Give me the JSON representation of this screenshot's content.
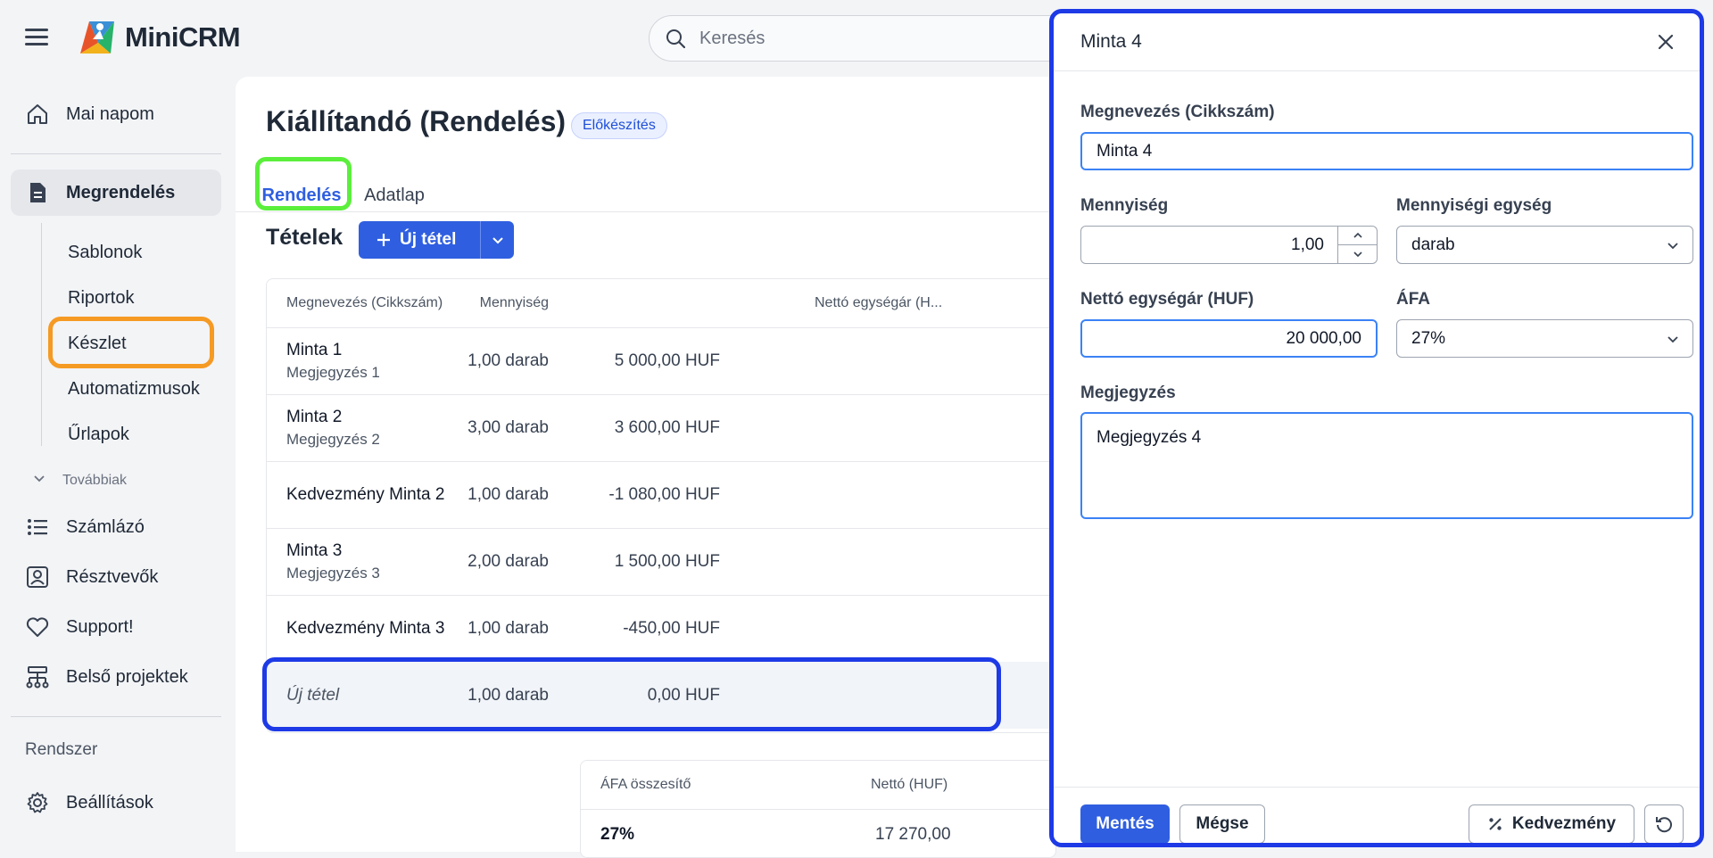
{
  "app": {
    "name": "MiniCRM"
  },
  "search": {
    "placeholder": "Keresés"
  },
  "sidebar": {
    "items": [
      {
        "label": "Mai napom",
        "icon": "home-icon"
      },
      {
        "label": "Megrendelés",
        "icon": "document-icon"
      },
      {
        "label": "Számlázó",
        "icon": "list-icon"
      },
      {
        "label": "Résztvevők",
        "icon": "contact-card-icon"
      },
      {
        "label": "Support!",
        "icon": "heart-icon"
      },
      {
        "label": "Belső projektek",
        "icon": "org-chart-icon"
      },
      {
        "label": "Beállítások",
        "icon": "gear-icon"
      }
    ],
    "sub_items": [
      "Sablonok",
      "Riportok",
      "Készlet",
      "Automatizmusok",
      "Űrlapok"
    ],
    "more_label": "Továbbiak",
    "system_label": "Rendszer"
  },
  "page": {
    "title": "Kiállítandó (Rendelés)",
    "status_badge": "Előkészítés",
    "tabs": [
      "Rendelés",
      "Adatlap"
    ],
    "section_title": "Tételek",
    "new_item_button": "Új tétel"
  },
  "table": {
    "headers": [
      "Megnevezés (Cikkszám)",
      "Mennyiség",
      "Nettó egységár (H..."
    ],
    "rows": [
      {
        "name": "Minta 1",
        "note": "Megjegyzés 1",
        "qty": "1,00 darab",
        "price": "5 000,00 HUF"
      },
      {
        "name": "Minta 2",
        "note": "Megjegyzés 2",
        "qty": "3,00 darab",
        "price": "3 600,00 HUF"
      },
      {
        "name": "Kedvezmény Minta 2",
        "note": "",
        "qty": "1,00 darab",
        "price": "-1 080,00 HUF"
      },
      {
        "name": "Minta 3",
        "note": "Megjegyzés 3",
        "qty": "2,00 darab",
        "price": "1 500,00 HUF"
      },
      {
        "name": "Kedvezmény Minta 3",
        "note": "",
        "qty": "1,00 darab",
        "price": "-450,00 HUF"
      }
    ],
    "new_row": {
      "name": "Új tétel",
      "qty": "1,00 darab",
      "price": "0,00 HUF"
    }
  },
  "vat_summary": {
    "headers": [
      "ÁFA összesítő",
      "Nettó (HUF)"
    ],
    "row": {
      "rate": "27%",
      "net": "17 270,00"
    }
  },
  "panel": {
    "title": "Minta 4",
    "name_label": "Megnevezés (Cikkszám)",
    "name_value": "Minta 4",
    "qty_label": "Mennyiség",
    "qty_value": "1,00",
    "unit_label": "Mennyiségi egység",
    "unit_value": "darab",
    "price_label": "Nettó egységár (HUF)",
    "price_value": "20 000,00",
    "vat_label": "ÁFA",
    "vat_value": "27%",
    "note_label": "Megjegyzés",
    "note_value": "Megjegyzés 4",
    "save_button": "Mentés",
    "cancel_button": "Mégse",
    "discount_button": "Kedvezmény"
  },
  "colors": {
    "accent": "#2f5fe0",
    "highlight_blue": "#1d3ae6",
    "highlight_green": "#5bef3c",
    "highlight_orange": "#f59a23"
  }
}
